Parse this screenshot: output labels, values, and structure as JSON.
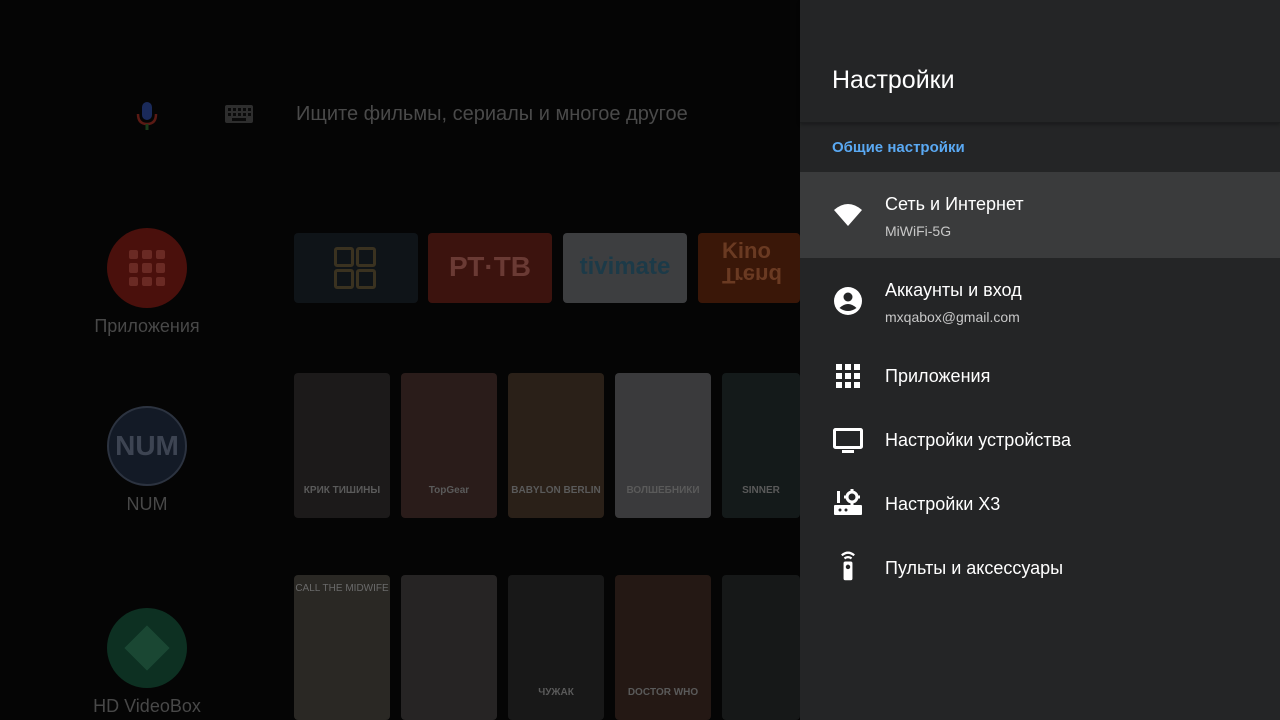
{
  "home": {
    "search_placeholder": "Ищите фильмы, сериалы и многое другое",
    "side_items": [
      {
        "label": "Приложения"
      },
      {
        "label": "NUM",
        "badge": "NUM"
      },
      {
        "label": "HD VideoBox"
      }
    ],
    "app_tiles": [
      {
        "name": "",
        "text": ""
      },
      {
        "name": "РТ ТВ",
        "text": "РТ·ТВ"
      },
      {
        "name": "TiViMate",
        "text": "tivimate"
      },
      {
        "name": "KinoTrend",
        "line1": "Kino",
        "line2": "Trend"
      }
    ],
    "posters_row1": [
      {
        "caption": "КРИК ТИШИНЫ",
        "color": "#1c1a1a"
      },
      {
        "caption": "TopGear",
        "color": "#2a1c1a"
      },
      {
        "caption": "BABYLON BERLIN",
        "color": "#2a2018"
      },
      {
        "caption": "ВОЛШЕБНИКИ",
        "color": "#3a3a3c"
      },
      {
        "caption": "SINNER",
        "color": "#141a1a"
      }
    ],
    "posters_row2": [
      {
        "caption": "CALL THE MIDWIFE",
        "color": "#2a2824"
      },
      {
        "caption": "",
        "color": "#262424"
      },
      {
        "caption": "ЧУЖАК",
        "color": "#181818"
      },
      {
        "caption": "DOCTOR WHO",
        "color": "#241814"
      },
      {
        "caption": "",
        "color": "#161818"
      }
    ]
  },
  "settings": {
    "title": "Настройки",
    "section": "Общие настройки",
    "items": [
      {
        "title": "Сеть и Интернет",
        "subtitle": "MiWiFi-5G",
        "icon": "wifi-icon"
      },
      {
        "title": "Аккаунты и вход",
        "subtitle": "mxqabox@gmail.com",
        "icon": "account-icon"
      },
      {
        "title": "Приложения",
        "icon": "apps-grid-icon"
      },
      {
        "title": "Настройки устройства",
        "icon": "tv-icon"
      },
      {
        "title": "Настройки X3",
        "icon": "device-settings-icon"
      },
      {
        "title": "Пульты и аксессуары",
        "icon": "remote-icon"
      }
    ]
  },
  "colors": {
    "panel_bg": "#242526",
    "focused_bg": "#3a3b3c",
    "section_accent": "#5aa9f3"
  }
}
